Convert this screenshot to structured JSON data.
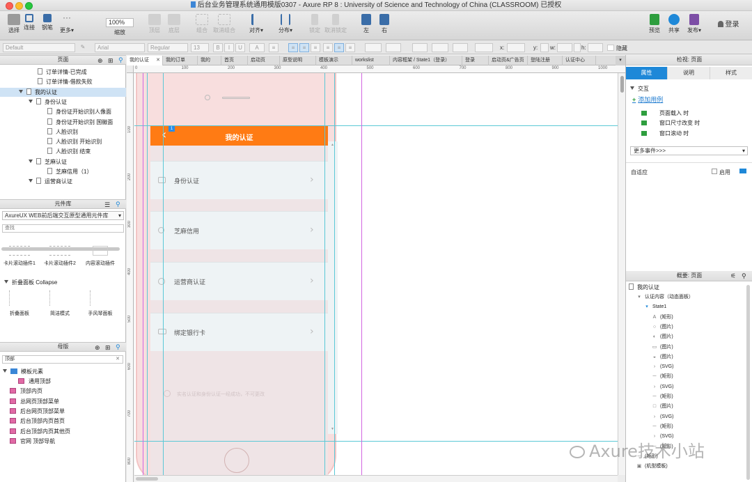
{
  "window": {
    "title": "后台业务管理系统通用模版0307 - Axure RP 8 : University of Science and Technology of China (CLASSROOM) 已授权"
  },
  "toolbar": {
    "buttons": [
      {
        "label": "选择",
        "name": "select"
      },
      {
        "label": "连接",
        "name": "connect"
      },
      {
        "label": "钢笔",
        "name": "pen"
      },
      {
        "label": "更多▾",
        "name": "more"
      }
    ],
    "zoom": "100%",
    "zoom_label": "缩放",
    "arrange": [
      {
        "label": "顶层"
      },
      {
        "label": "底层"
      },
      {
        "label": "组合"
      },
      {
        "label": "取消组合"
      },
      {
        "label": "对齐▾"
      },
      {
        "label": "分布▾"
      },
      {
        "label": "锁定"
      },
      {
        "label": "取消锁定"
      },
      {
        "label": "左"
      },
      {
        "label": "右"
      }
    ],
    "preview": "预览",
    "share": "共享",
    "publish": "发布▾",
    "login": "登录"
  },
  "format": {
    "style": "Default",
    "font": "Arial",
    "weight": "Regular",
    "size": "13",
    "x": "x:",
    "y": "y:",
    "w": "w:",
    "h": "h:",
    "hidden": "隐藏"
  },
  "left": {
    "pages_title": "页面",
    "pages": [
      {
        "label": "订单详情-已完成",
        "indent": 1
      },
      {
        "label": "订单详情-借款失败",
        "indent": 1
      },
      {
        "label": "我的认证",
        "indent": 0,
        "expanded": true,
        "selected": true
      },
      {
        "label": "身份认证",
        "indent": 1,
        "expanded": true
      },
      {
        "label": "身份证开始识别人像面",
        "indent": 2
      },
      {
        "label": "身份证开始识别 国徽面",
        "indent": 2
      },
      {
        "label": "人脸识别",
        "indent": 2
      },
      {
        "label": "人脸识别 开始识别",
        "indent": 2
      },
      {
        "label": "人脸识别 结束",
        "indent": 2
      },
      {
        "label": "芝麻认证",
        "indent": 1,
        "expanded": true
      },
      {
        "label": "芝麻信用（1）",
        "indent": 2
      },
      {
        "label": "运营商认证",
        "indent": 1,
        "expanded": true
      }
    ],
    "library_title": "元件库",
    "library_select": "AxureUX WEB前后端交互原型通用元件库",
    "library_search": "查找",
    "widgets": [
      {
        "label": "卡片滚动插件1"
      },
      {
        "label": "卡片滚动插件2"
      },
      {
        "label": "内容滚动插件"
      }
    ],
    "group_title": "折叠面板 Collapse",
    "widgets2": [
      {
        "label": "折叠面板"
      },
      {
        "label": "简洁模式"
      },
      {
        "label": "手风琴面板"
      }
    ],
    "masters_title": "母版",
    "masters_search": "顶部",
    "masters_folder": "模板元素",
    "masters": [
      {
        "label": "通用顶部",
        "indent": 1
      },
      {
        "label": "顶部内页",
        "indent": 0
      },
      {
        "label": "总网页顶部菜单",
        "indent": 0
      },
      {
        "label": "后台网页顶部菜单",
        "indent": 0
      },
      {
        "label": "后台顶部内页首页",
        "indent": 0
      },
      {
        "label": "后台顶部内页其他页",
        "indent": 0
      },
      {
        "label": "官网 顶部导航",
        "indent": 0
      }
    ]
  },
  "tabs": [
    {
      "label": "我的认证",
      "active": true
    },
    {
      "label": "我的订单"
    },
    {
      "label": "我的"
    },
    {
      "label": "首页"
    },
    {
      "label": "启动页"
    },
    {
      "label": "原型说明"
    },
    {
      "label": "模板演示"
    },
    {
      "label": "workslist"
    },
    {
      "label": "内容框架 / State1（登录）"
    },
    {
      "label": "登录"
    },
    {
      "label": "启动页&广告页"
    },
    {
      "label": "登陆注册"
    },
    {
      "label": "认证中心"
    }
  ],
  "ruler": {
    "h": [
      "0",
      "100",
      "200",
      "300",
      "400",
      "500",
      "600",
      "700",
      "800",
      "900",
      "1000"
    ],
    "v": [
      "100",
      "200",
      "300",
      "400",
      "500",
      "600",
      "700",
      "800"
    ]
  },
  "phone": {
    "header_title": "我的认证",
    "back": "‹",
    "badge": "1",
    "items": [
      {
        "label": "身份认证"
      },
      {
        "label": "芝麻信用"
      },
      {
        "label": "运营商认证"
      },
      {
        "label": "绑定银行卡"
      }
    ],
    "notice": "实名认证和身份认证一经成功，不可更改",
    "scroll_up": "▲",
    "scroll_down": "▼"
  },
  "inspector": {
    "title": "检视: 页面",
    "tabs": [
      {
        "label": "属性",
        "active": true
      },
      {
        "label": "说明"
      },
      {
        "label": "样式"
      }
    ],
    "section": "交互",
    "add_case": "添加用例",
    "events": [
      {
        "label": "页面载入 时"
      },
      {
        "label": "窗口尺寸改变 时"
      },
      {
        "label": "窗口滚动 时"
      }
    ],
    "more_events": "更多事件>>>",
    "adaptive": "自适应",
    "enable": "启用"
  },
  "outline": {
    "title": "概要: 页面",
    "root": "我的认证",
    "rows": [
      {
        "icon": "▾",
        "label": "认证内容（动态面板）",
        "indent": 1
      },
      {
        "icon": "▾",
        "label": "State1",
        "indent": 2
      },
      {
        "icon": "A",
        "label": "(矩形)",
        "indent": 3
      },
      {
        "icon": "○",
        "label": "(图片)",
        "indent": 3
      },
      {
        "icon": "◐",
        "label": "(图片)",
        "indent": 3
      },
      {
        "icon": "▭",
        "label": "(图片)",
        "indent": 3
      },
      {
        "icon": "◒",
        "label": "(图片)",
        "indent": 3
      },
      {
        "icon": "›",
        "label": "(SVG)",
        "indent": 3
      },
      {
        "icon": "─",
        "label": "(矩形)",
        "indent": 3
      },
      {
        "icon": "›",
        "label": "(SVG)",
        "indent": 3
      },
      {
        "icon": "─",
        "label": "(矩形)",
        "indent": 3
      },
      {
        "icon": "□",
        "label": "(图片)",
        "indent": 3
      },
      {
        "icon": "›",
        "label": "(SVG)",
        "indent": 3
      },
      {
        "icon": "─",
        "label": "(矩形)",
        "indent": 3
      },
      {
        "icon": "›",
        "label": "(SVG)",
        "indent": 3
      },
      {
        "icon": "─",
        "label": "(矩形)",
        "indent": 3
      },
      {
        "icon": "─",
        "label": "(矩形)",
        "indent": 1
      },
      {
        "icon": "▣",
        "label": "(机型模板)",
        "indent": 1
      }
    ]
  },
  "watermark": "Axure技术小站"
}
